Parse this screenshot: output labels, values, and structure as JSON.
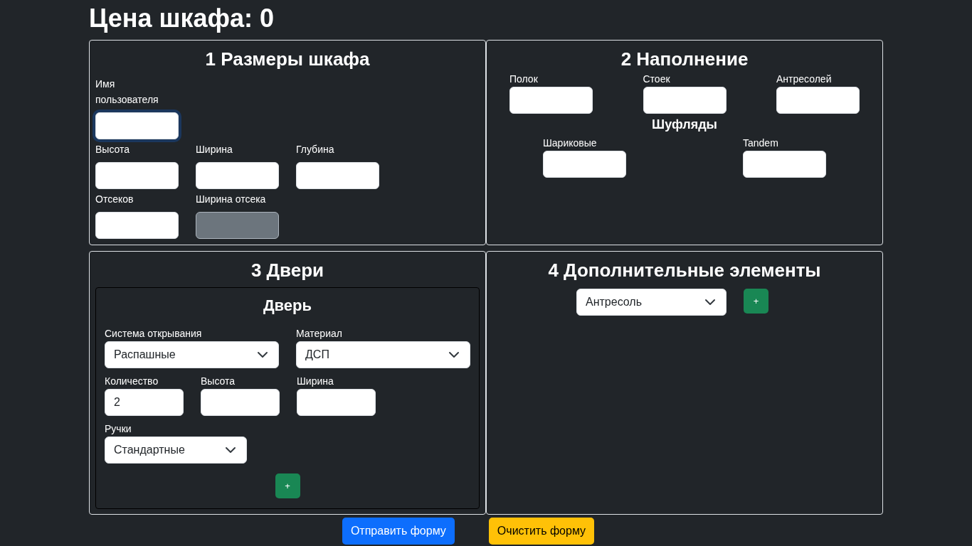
{
  "price_title": "Цена шкафа: 0",
  "dimensions": {
    "title": "1 Размеры шкафа",
    "rows": [
      [
        {
          "label": "Имя пользователя",
          "focused": true,
          "disabled": false
        }
      ],
      [
        {
          "label": "Высота",
          "focused": false,
          "disabled": false
        },
        {
          "label": "Ширина",
          "focused": false,
          "disabled": false
        },
        {
          "label": "Глубина",
          "focused": false,
          "disabled": false
        }
      ],
      [
        {
          "label": "Отсеков",
          "focused": false,
          "disabled": false
        },
        {
          "label": "Ширина отсека",
          "focused": false,
          "disabled": true
        }
      ]
    ]
  },
  "filling": {
    "title": "2 Наполнение",
    "fields": [
      {
        "label": "Полок"
      },
      {
        "label": "Стоек"
      },
      {
        "label": "Антресолей"
      }
    ],
    "drawers": {
      "title": "Шуфляды",
      "fields": [
        {
          "label": "Шариковые"
        },
        {
          "label": "Tandem"
        }
      ]
    }
  },
  "doors": {
    "title": "3 Двери",
    "door": {
      "title": "Дверь",
      "options": [
        {
          "label": "Система открывания",
          "value": "Распашные"
        },
        {
          "label": "Материал",
          "value": "ДСП"
        }
      ],
      "sizes": [
        {
          "label": "Количество",
          "value": "2"
        },
        {
          "label": "Высота"
        },
        {
          "label": "Ширина"
        }
      ],
      "handles": {
        "label": "Ручки",
        "value": "Стандартные"
      },
      "add_button": "+"
    }
  },
  "extras": {
    "title": "4 Дополнительные элементы",
    "select": "Антресоль",
    "add_button": "+"
  },
  "buttons": [
    {
      "label": "Отправить форму",
      "kind": "primary"
    },
    {
      "label": "Очистить форму",
      "kind": "warning"
    }
  ]
}
